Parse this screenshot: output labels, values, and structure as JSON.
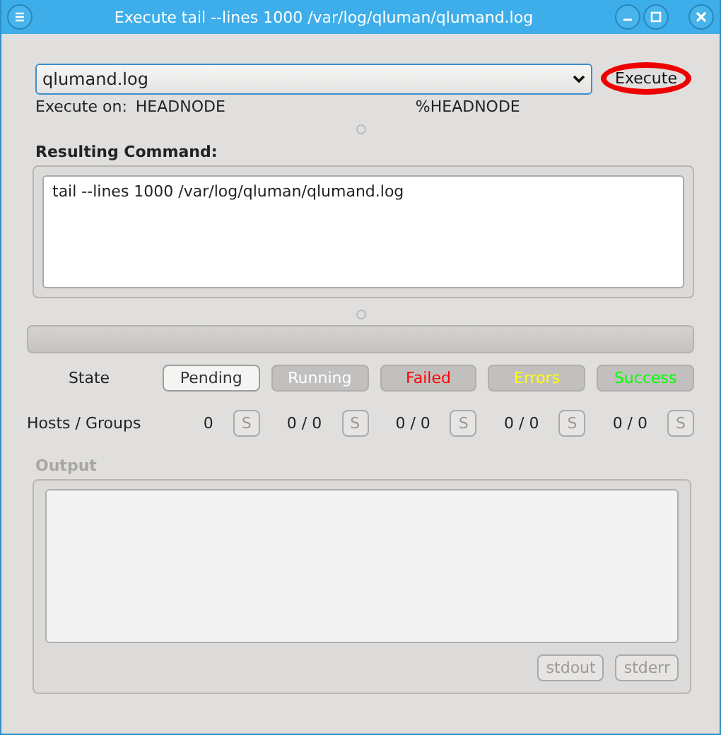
{
  "window": {
    "title": "Execute tail --lines 1000 /var/log/qluman/qlumand.log"
  },
  "command_select": {
    "value": "qlumand.log"
  },
  "execute_button": {
    "label": "Execute",
    "circled": true
  },
  "execute_on": {
    "label": "Execute on:",
    "value": "HEADNODE",
    "target": "%HEADNODE"
  },
  "resulting_command": {
    "title": "Resulting Command:",
    "text": "tail --lines 1000 /var/log/qluman/qlumand.log"
  },
  "progress": {
    "level": 0
  },
  "state": {
    "label": "State",
    "buttons": [
      {
        "label": "Pending",
        "disabled": false,
        "color": "#333333"
      },
      {
        "label": "Running",
        "disabled": true,
        "color": "#ffffff"
      },
      {
        "label": "Failed",
        "disabled": true,
        "color": "#ff0000"
      },
      {
        "label": "Errors",
        "disabled": true,
        "color": "#ffff00"
      },
      {
        "label": "Success",
        "disabled": true,
        "color": "#00ff00"
      }
    ]
  },
  "hosts_groups": {
    "label": "Hosts / Groups",
    "items": [
      {
        "count": "0",
        "button": "S",
        "disabled": true
      },
      {
        "count": "0 / 0",
        "button": "S",
        "disabled": true
      },
      {
        "count": "0 / 0",
        "button": "S",
        "disabled": true
      },
      {
        "count": "0 / 0",
        "button": "S",
        "disabled": true
      },
      {
        "count": "0 / 0",
        "button": "S",
        "disabled": true
      }
    ]
  },
  "output": {
    "title": "Output",
    "disabled": true,
    "buttons": [
      {
        "label": "stdout",
        "disabled": true
      },
      {
        "label": "stderr",
        "disabled": true
      }
    ]
  }
}
